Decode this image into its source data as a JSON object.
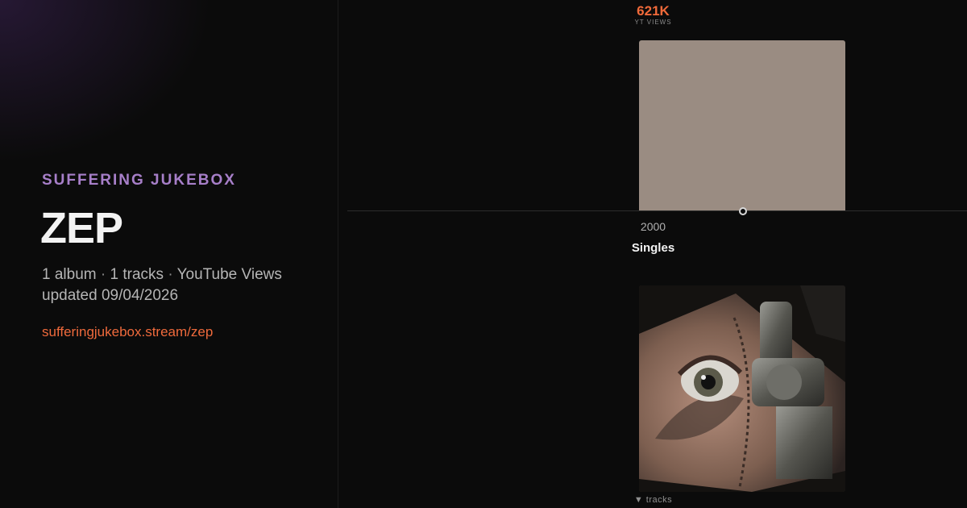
{
  "brand": "SUFFERING JUKEBOX",
  "artist": "ZEP",
  "meta": {
    "albums": "1 album",
    "separator": "·",
    "tracks": "1 tracks",
    "metric": "YouTube Views",
    "updated": "updated 09/04/2026"
  },
  "site_link": "sufferingjukebox.stream/zep",
  "chart": {
    "value_label": "621K",
    "value_caption": "YT VIEWS",
    "year": "2000",
    "album_title": "Singles",
    "bar_color": "#9a8c82",
    "accent": "#f06a3a"
  },
  "album_cover_icon": "album-artwork-eye-close-up",
  "tracks_toggle": "▼ tracks",
  "colors": {
    "brand": "#a77fc9",
    "link": "#ef6a3c",
    "background": "#0b0b0b"
  }
}
